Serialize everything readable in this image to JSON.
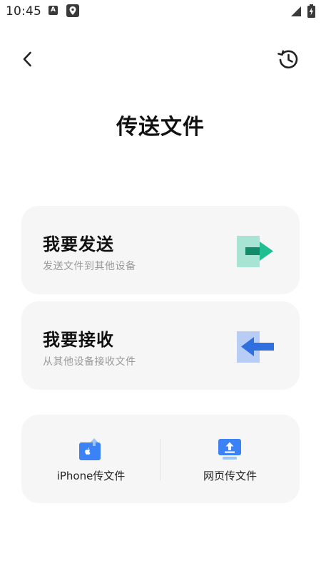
{
  "status_bar": {
    "time": "10:45",
    "notification_icons": [
      "a-icon",
      "map-pin-icon"
    ],
    "signal_icon": "signal-icon",
    "battery_icon": "battery-charging-icon"
  },
  "header": {
    "back_icon": "chevron-left-icon",
    "history_icon": "history-icon",
    "title": "传送文件"
  },
  "actions": {
    "send": {
      "title": "我要发送",
      "subtitle": "发送文件到其他设备",
      "icon": "arrow-right-icon",
      "accent": "#1fbf93"
    },
    "receive": {
      "title": "我要接收",
      "subtitle": "从其他设备接收文件",
      "icon": "arrow-left-icon",
      "accent": "#2f6fe0"
    }
  },
  "tools": {
    "iphone": {
      "label": "iPhone传文件",
      "icon": "iphone-transfer-icon"
    },
    "web": {
      "label": "网页传文件",
      "icon": "web-monitor-icon"
    }
  },
  "colors": {
    "card_bg": "#f6f6f6",
    "blue": "#3b82f6",
    "green": "#1fbf93"
  }
}
